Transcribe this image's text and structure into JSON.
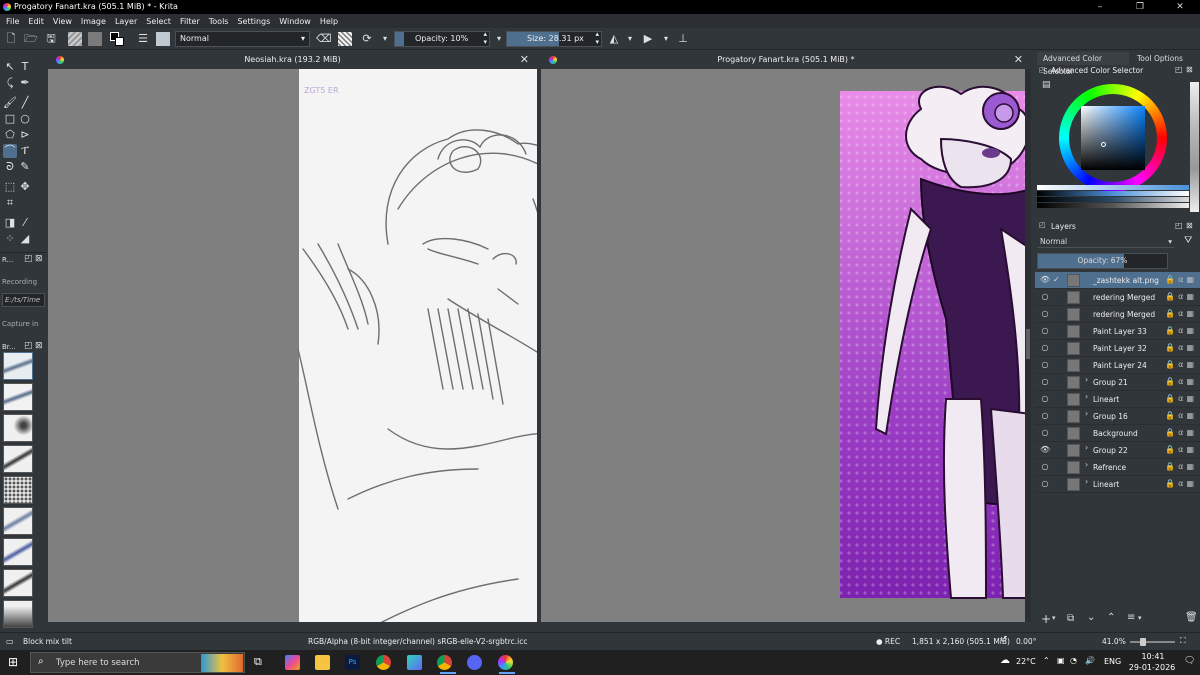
{
  "window": {
    "title": "Progatory Fanart.kra (505.1 MiB) * - Krita",
    "controls": [
      "–",
      "❐",
      "✕"
    ]
  },
  "menu": [
    "File",
    "Edit",
    "View",
    "Image",
    "Layer",
    "Select",
    "Filter",
    "Tools",
    "Settings",
    "Window",
    "Help"
  ],
  "toolbar": {
    "blend_mode": "Normal",
    "opacity_label": "Opacity: 10%",
    "opacity_value": 0.1,
    "size_label": "Size: 28.31 px"
  },
  "left_dockers": {
    "recorder_title": "R...",
    "recording_label": "Recording",
    "recording_path_placeholder": "E:/ts/Time",
    "capture_label": "Capture in",
    "brushes_title": "Br..."
  },
  "tabs": [
    {
      "label": "Neosiah.kra (193.2 MiB)"
    },
    {
      "label": "Progatory Fanart.kra (505.1 MiB) *"
    }
  ],
  "canvas": {
    "sketch_signature": "ZGT5 ER",
    "artwork_bg_color": "#8b2fb0",
    "artwork_accent": "#e67fe0"
  },
  "color_selector": {
    "tab_advanced": "Advanced Color Selector",
    "tab_tool_options": "Tool Options",
    "title": "Advanced Color Selector",
    "current_color": "#2c4a66"
  },
  "layers": {
    "title": "Layers",
    "blend_mode": "Normal",
    "opacity_label": "Opacity:  67%",
    "opacity_value": 0.67,
    "items": [
      {
        "name": "_zashtekk alt.png",
        "visible": true,
        "selected": true,
        "type": "image"
      },
      {
        "name": "redering Merged",
        "visible": false,
        "selected": false,
        "type": "paint"
      },
      {
        "name": "redering Merged",
        "visible": false,
        "selected": false,
        "type": "paint"
      },
      {
        "name": "Paint Layer 33",
        "visible": false,
        "selected": false,
        "type": "paint"
      },
      {
        "name": "Paint Layer 32",
        "visible": false,
        "selected": false,
        "type": "paint"
      },
      {
        "name": "Paint Layer 24",
        "visible": false,
        "selected": false,
        "type": "paint"
      },
      {
        "name": "Group 21",
        "visible": false,
        "selected": false,
        "type": "group"
      },
      {
        "name": "Lineart",
        "visible": false,
        "selected": false,
        "type": "group"
      },
      {
        "name": "Group 16",
        "visible": false,
        "selected": false,
        "type": "group"
      },
      {
        "name": "Background",
        "visible": false,
        "selected": false,
        "type": "paint"
      },
      {
        "name": "Group 22",
        "visible": true,
        "selected": false,
        "type": "group"
      },
      {
        "name": "Refrence",
        "visible": false,
        "selected": false,
        "type": "group"
      },
      {
        "name": "Lineart",
        "visible": false,
        "selected": false,
        "type": "group"
      }
    ]
  },
  "statusbar": {
    "brush_name": "Block mix tilt",
    "color_profile": "RGB/Alpha (8-bit integer/channel)  sRGB-elle-V2-srgbtrc.icc",
    "rec": "● REC",
    "dimensions": "1,851 x 2,160 (505.1 MiB)",
    "rotation": "0.00°",
    "zoom": "41.0%"
  },
  "taskbar": {
    "search_placeholder": "Type here to search",
    "temperature": "22°C",
    "language": "ENG",
    "time": "10:41",
    "date": "29-01-2026"
  }
}
